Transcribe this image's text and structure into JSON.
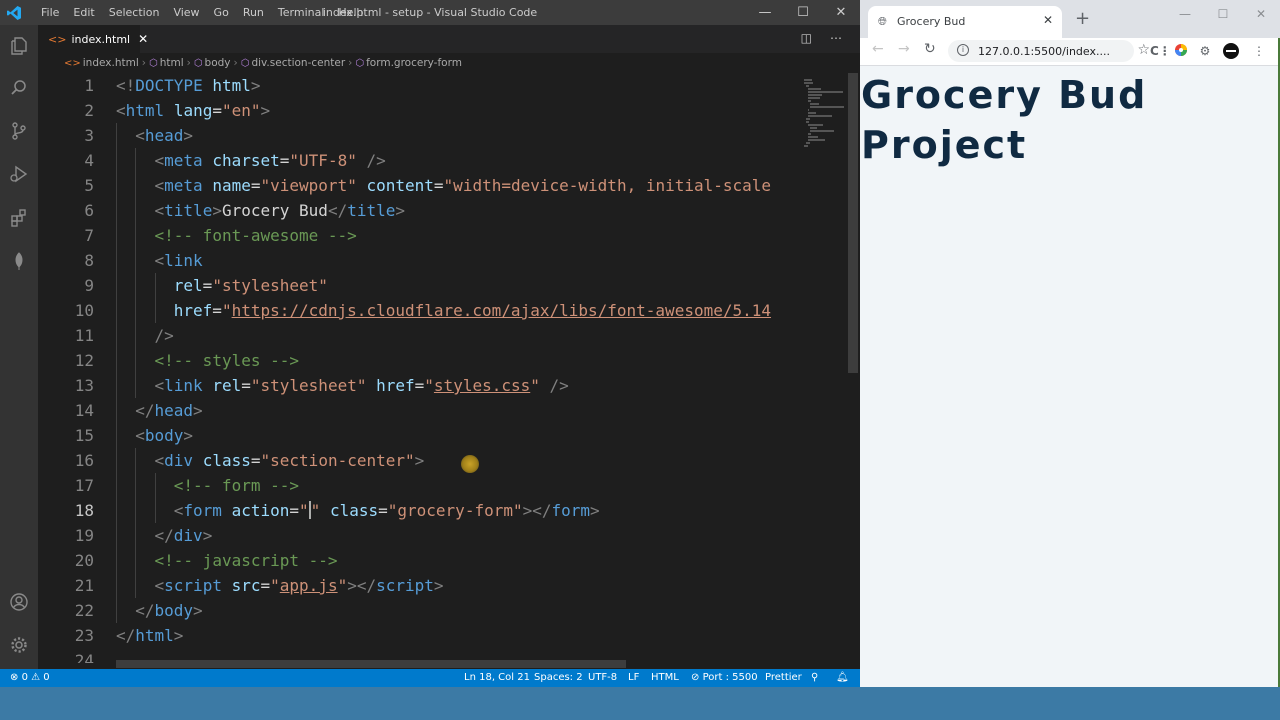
{
  "vscode": {
    "menu": [
      "File",
      "Edit",
      "Selection",
      "View",
      "Go",
      "Run",
      "Terminal",
      "Help"
    ],
    "window_title": "index.html - setup - Visual Studio Code",
    "tab": {
      "label": "index.html"
    },
    "breadcrumb": [
      "index.html",
      "html",
      "body",
      "div.section-center",
      "form.grocery-form"
    ],
    "active_line": 18,
    "lines": [
      {
        "n": 1,
        "indent": 0,
        "tokens": [
          [
            "b",
            "<!"
          ],
          [
            "tag",
            "DOCTYPE"
          ],
          [
            "txt",
            " "
          ],
          [
            "attr",
            "html"
          ],
          [
            "b",
            ">"
          ]
        ]
      },
      {
        "n": 2,
        "indent": 0,
        "tokens": [
          [
            "b",
            "<"
          ],
          [
            "tag",
            "html"
          ],
          [
            "txt",
            " "
          ],
          [
            "attr",
            "lang"
          ],
          [
            "txt",
            "="
          ],
          [
            "str",
            "\"en\""
          ],
          [
            "b",
            ">"
          ]
        ]
      },
      {
        "n": 3,
        "indent": 1,
        "tokens": [
          [
            "b",
            "<"
          ],
          [
            "tag",
            "head"
          ],
          [
            "b",
            ">"
          ]
        ]
      },
      {
        "n": 4,
        "indent": 2,
        "tokens": [
          [
            "b",
            "<"
          ],
          [
            "tag",
            "meta"
          ],
          [
            "txt",
            " "
          ],
          [
            "attr",
            "charset"
          ],
          [
            "txt",
            "="
          ],
          [
            "str",
            "\"UTF-8\""
          ],
          [
            "txt",
            " "
          ],
          [
            "b",
            "/>"
          ]
        ]
      },
      {
        "n": 5,
        "indent": 2,
        "tokens": [
          [
            "b",
            "<"
          ],
          [
            "tag",
            "meta"
          ],
          [
            "txt",
            " "
          ],
          [
            "attr",
            "name"
          ],
          [
            "txt",
            "="
          ],
          [
            "str",
            "\"viewport\""
          ],
          [
            "txt",
            " "
          ],
          [
            "attr",
            "content"
          ],
          [
            "txt",
            "="
          ],
          [
            "str",
            "\"width=device-width, initial-scale"
          ]
        ]
      },
      {
        "n": 6,
        "indent": 2,
        "tokens": [
          [
            "b",
            "<"
          ],
          [
            "tag",
            "title"
          ],
          [
            "b",
            ">"
          ],
          [
            "txt",
            "Grocery Bud"
          ],
          [
            "b",
            "</"
          ],
          [
            "tag",
            "title"
          ],
          [
            "b",
            ">"
          ]
        ]
      },
      {
        "n": 7,
        "indent": 2,
        "tokens": [
          [
            "cmt",
            "<!-- font-awesome -->"
          ]
        ]
      },
      {
        "n": 8,
        "indent": 2,
        "tokens": [
          [
            "b",
            "<"
          ],
          [
            "tag",
            "link"
          ]
        ]
      },
      {
        "n": 9,
        "indent": 3,
        "tokens": [
          [
            "attr",
            "rel"
          ],
          [
            "txt",
            "="
          ],
          [
            "str",
            "\"stylesheet\""
          ]
        ]
      },
      {
        "n": 10,
        "indent": 3,
        "tokens": [
          [
            "attr",
            "href"
          ],
          [
            "txt",
            "="
          ],
          [
            "str",
            "\""
          ],
          [
            "stru",
            "https://cdnjs.cloudflare.com/ajax/libs/font-awesome/5.14"
          ]
        ]
      },
      {
        "n": 11,
        "indent": 2,
        "tokens": [
          [
            "b",
            "/>"
          ]
        ]
      },
      {
        "n": 12,
        "indent": 2,
        "tokens": [
          [
            "cmt",
            "<!-- styles -->"
          ]
        ]
      },
      {
        "n": 13,
        "indent": 2,
        "tokens": [
          [
            "b",
            "<"
          ],
          [
            "tag",
            "link"
          ],
          [
            "txt",
            " "
          ],
          [
            "attr",
            "rel"
          ],
          [
            "txt",
            "="
          ],
          [
            "str",
            "\"stylesheet\""
          ],
          [
            "txt",
            " "
          ],
          [
            "attr",
            "href"
          ],
          [
            "txt",
            "="
          ],
          [
            "str",
            "\""
          ],
          [
            "stru",
            "styles.css"
          ],
          [
            "str",
            "\""
          ],
          [
            "txt",
            " "
          ],
          [
            "b",
            "/>"
          ]
        ]
      },
      {
        "n": 14,
        "indent": 1,
        "tokens": [
          [
            "b",
            "</"
          ],
          [
            "tag",
            "head"
          ],
          [
            "b",
            ">"
          ]
        ]
      },
      {
        "n": 15,
        "indent": 1,
        "tokens": [
          [
            "b",
            "<"
          ],
          [
            "tag",
            "body"
          ],
          [
            "b",
            ">"
          ]
        ]
      },
      {
        "n": 16,
        "indent": 2,
        "tokens": [
          [
            "b",
            "<"
          ],
          [
            "tag",
            "div"
          ],
          [
            "txt",
            " "
          ],
          [
            "attr",
            "class"
          ],
          [
            "txt",
            "="
          ],
          [
            "str",
            "\"section-center\""
          ],
          [
            "b",
            ">"
          ]
        ]
      },
      {
        "n": 17,
        "indent": 3,
        "tokens": [
          [
            "cmt",
            "<!-- form -->"
          ]
        ]
      },
      {
        "n": 18,
        "indent": 3,
        "tokens": [
          [
            "b",
            "<"
          ],
          [
            "tag",
            "form"
          ],
          [
            "txt",
            " "
          ],
          [
            "attr",
            "action"
          ],
          [
            "txt",
            "="
          ],
          [
            "str",
            "\""
          ],
          [
            "cursor",
            ""
          ],
          [
            "str",
            "\""
          ],
          [
            "txt",
            " "
          ],
          [
            "attr",
            "class"
          ],
          [
            "txt",
            "="
          ],
          [
            "str",
            "\"grocery-form\""
          ],
          [
            "b",
            "></"
          ],
          [
            "tag",
            "form"
          ],
          [
            "b",
            ">"
          ]
        ]
      },
      {
        "n": 19,
        "indent": 2,
        "tokens": [
          [
            "b",
            "</"
          ],
          [
            "tag",
            "div"
          ],
          [
            "b",
            ">"
          ]
        ]
      },
      {
        "n": 20,
        "indent": 2,
        "tokens": [
          [
            "cmt",
            "<!-- javascript -->"
          ]
        ]
      },
      {
        "n": 21,
        "indent": 2,
        "tokens": [
          [
            "b",
            "<"
          ],
          [
            "tag",
            "script"
          ],
          [
            "txt",
            " "
          ],
          [
            "attr",
            "src"
          ],
          [
            "txt",
            "="
          ],
          [
            "str",
            "\""
          ],
          [
            "stru",
            "app.js"
          ],
          [
            "str",
            "\""
          ],
          [
            "b",
            "></"
          ],
          [
            "tag",
            "script"
          ],
          [
            "b",
            ">"
          ]
        ]
      },
      {
        "n": 22,
        "indent": 1,
        "tokens": [
          [
            "b",
            "</"
          ],
          [
            "tag",
            "body"
          ],
          [
            "b",
            ">"
          ]
        ]
      },
      {
        "n": 23,
        "indent": 0,
        "tokens": [
          [
            "b",
            "</"
          ],
          [
            "tag",
            "html"
          ],
          [
            "b",
            ">"
          ]
        ]
      },
      {
        "n": 24,
        "indent": 0,
        "tokens": []
      }
    ],
    "status": {
      "errors": "0",
      "warnings": "0",
      "position": "Ln 18, Col 21",
      "spaces": "Spaces: 2",
      "encoding": "UTF-8",
      "eol": "LF",
      "language": "HTML",
      "port": "Port : 5500",
      "formatter": "Prettier"
    }
  },
  "chrome": {
    "tab_title": "Grocery Bud",
    "url": "127.0.0.1:5500/index....",
    "page_heading": "Grocery Bud Project"
  }
}
